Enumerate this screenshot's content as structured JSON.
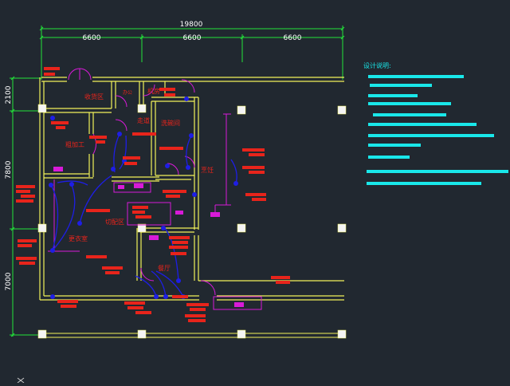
{
  "drawing": {
    "colors": {
      "background": "#212830",
      "dimension": "#22e33a",
      "wall": "#f2f25a",
      "annotation": "#e8241b",
      "wiring": "#1e1ee6",
      "equipment": "#d81ad8",
      "notes": "#19e8ea",
      "column": "#f4f4f4"
    },
    "dimensions": {
      "overall": "19800",
      "bays": [
        "6600",
        "6600",
        "6600"
      ],
      "vertical": [
        "2100",
        "7800",
        "7000"
      ]
    },
    "rooms": [
      {
        "id": "storage",
        "label": "收货区"
      },
      {
        "id": "office",
        "label": "办公"
      },
      {
        "id": "electrical",
        "label": "机房"
      },
      {
        "id": "corridor",
        "label": "走道"
      },
      {
        "id": "washroom",
        "label": "洗碗间"
      },
      {
        "id": "rough-processing",
        "label": "粗加工"
      },
      {
        "id": "cooking",
        "label": "烹饪"
      },
      {
        "id": "cutting",
        "label": "切配区"
      },
      {
        "id": "staff",
        "label": "更衣室"
      },
      {
        "id": "dining",
        "label": "餐厅"
      }
    ],
    "notes": {
      "title": "设计说明:"
    }
  }
}
